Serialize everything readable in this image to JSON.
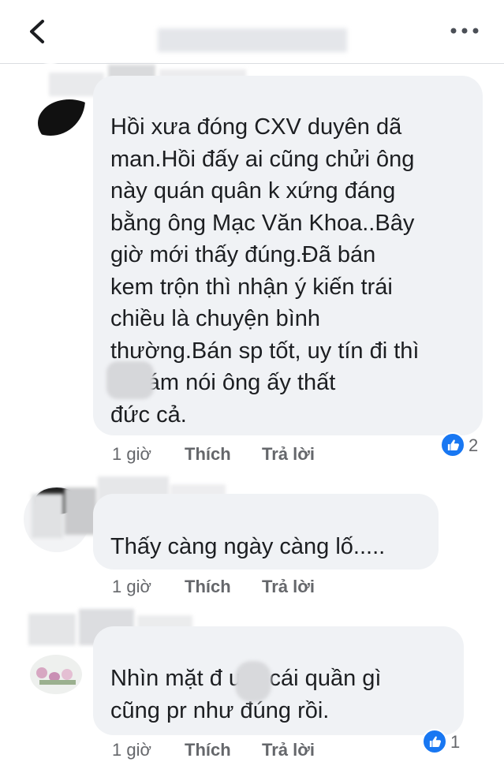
{
  "header": {
    "back_icon": "chevron-left-icon",
    "more_icon": "more-horizontal-icon"
  },
  "comments": [
    {
      "text": "Hồi xưa đóng CXV duyên dã\nman.Hồi đấy ai cũng chửi ông\nnày quán quân k xứng đáng\nbằng ông Mạc Văn Khoa..Bây\ngiờ mới thấy đúng.Đã bán\nkem trộn thì nhận ý kiến trái\nchiều là chuyện bình\nthường.Bán sp tốt, uy tín đi thì\n     ai dám nói ông ấy thất\nđức cả.",
      "time": "1 giờ",
      "like_label": "Thích",
      "reply_label": "Trả lời",
      "reaction_count": "2"
    },
    {
      "text": "Thấy càng ngày càng lố.....",
      "time": "1 giờ",
      "like_label": "Thích",
      "reply_label": "Trả lời",
      "reaction_count": ""
    },
    {
      "text": "Nhìn mặt đ     ưa, cái quần gì\ncũng pr như đúng rồi.",
      "time": "1 giờ",
      "like_label": "Thích",
      "reply_label": "Trả lời",
      "reaction_count": "1"
    }
  ],
  "colors": {
    "bubble": "#f0f2f5",
    "meta_text": "#65676b",
    "like_blue": "#1877f2"
  }
}
